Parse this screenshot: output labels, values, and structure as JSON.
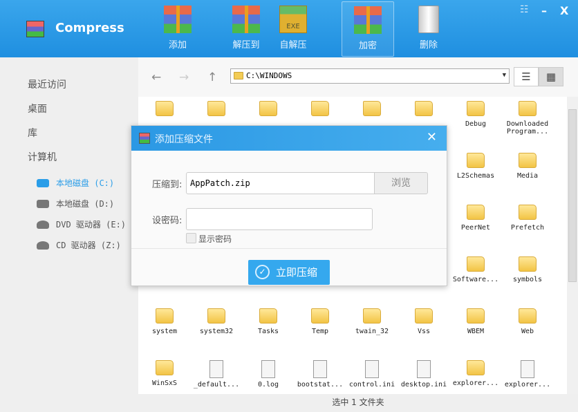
{
  "app": {
    "title": "Compress",
    "brand_color": "#2196e3"
  },
  "toolbar": [
    {
      "label": "添加",
      "icon": "add-archive-icon"
    },
    {
      "label": "解压到",
      "icon": "extract-icon"
    },
    {
      "label": "自解压",
      "icon": "exe-sfx-icon",
      "badge": "EXE"
    },
    {
      "label": "加密",
      "icon": "lock-archive-icon",
      "active": true
    },
    {
      "label": "删除",
      "icon": "trash-icon"
    }
  ],
  "window": {
    "menu": "menu-icon",
    "minimize": "–",
    "close": "X"
  },
  "sidebar": {
    "items": [
      {
        "label": "最近访问"
      },
      {
        "label": "桌面"
      },
      {
        "label": "库"
      },
      {
        "label": "计算机"
      }
    ],
    "drives": [
      {
        "label": "本地磁盘 (C:)",
        "selected": true
      },
      {
        "label": "本地磁盘 (D:)"
      },
      {
        "label": "DVD 驱动器 (E:)"
      },
      {
        "label": "CD 驱动器 (Z:)"
      }
    ]
  },
  "nav": {
    "back": "←",
    "forward": "→",
    "up": "↑",
    "path": "C:\\WINDOWS",
    "list_view": "☰",
    "grid_view": "▦"
  },
  "files": [
    {
      "name": "",
      "type": "folder",
      "row": 0,
      "col": 0
    },
    {
      "name": "",
      "type": "folder",
      "row": 0,
      "col": 1
    },
    {
      "name": "",
      "type": "folder",
      "row": 0,
      "col": 2
    },
    {
      "name": "",
      "type": "folder",
      "row": 0,
      "col": 3
    },
    {
      "name": "",
      "type": "folder",
      "row": 0,
      "col": 4
    },
    {
      "name": "",
      "type": "folder",
      "row": 0,
      "col": 5
    },
    {
      "name": "Debug",
      "type": "folder",
      "row": 0,
      "col": 6
    },
    {
      "name": "Downloaded Program...",
      "type": "folder",
      "row": 0,
      "col": 7
    },
    {
      "name": "L2Schemas",
      "type": "folder",
      "row": 1,
      "col": 6
    },
    {
      "name": "Media",
      "type": "folder",
      "row": 1,
      "col": 7
    },
    {
      "name": "PeerNet",
      "type": "folder",
      "row": 2,
      "col": 6
    },
    {
      "name": "Prefetch",
      "type": "folder",
      "row": 2,
      "col": 7
    },
    {
      "name": "Software...",
      "type": "folder",
      "row": 3,
      "col": 6
    },
    {
      "name": "symbols",
      "type": "folder",
      "row": 3,
      "col": 7
    },
    {
      "name": "system",
      "type": "folder",
      "row": 4,
      "col": 0
    },
    {
      "name": "system32",
      "type": "folder",
      "row": 4,
      "col": 1
    },
    {
      "name": "Tasks",
      "type": "folder",
      "row": 4,
      "col": 2
    },
    {
      "name": "Temp",
      "type": "folder",
      "row": 4,
      "col": 3
    },
    {
      "name": "twain_32",
      "type": "folder",
      "row": 4,
      "col": 4
    },
    {
      "name": "Vss",
      "type": "folder",
      "row": 4,
      "col": 5
    },
    {
      "name": "WBEM",
      "type": "folder",
      "row": 4,
      "col": 6
    },
    {
      "name": "Web",
      "type": "folder",
      "row": 4,
      "col": 7
    },
    {
      "name": "WinSxS",
      "type": "folder",
      "row": 5,
      "col": 0
    },
    {
      "name": "_default...",
      "type": "file",
      "row": 5,
      "col": 1
    },
    {
      "name": "0.log",
      "type": "file",
      "row": 5,
      "col": 2
    },
    {
      "name": "bootstat...",
      "type": "file",
      "row": 5,
      "col": 3
    },
    {
      "name": "control.ini",
      "type": "file",
      "row": 5,
      "col": 4
    },
    {
      "name": "desktop.ini",
      "type": "file",
      "row": 5,
      "col": 5
    },
    {
      "name": "explorer...",
      "type": "folder",
      "row": 5,
      "col": 6
    },
    {
      "name": "explorer...",
      "type": "file",
      "row": 5,
      "col": 7
    }
  ],
  "status": "选中 1 文件夹",
  "dialog": {
    "title": "添加压缩文件",
    "close": "✕",
    "dest_label": "压缩到:",
    "dest_value": "AppPatch.zip",
    "browse": "浏览",
    "pwd_label": "设密码:",
    "pwd_value": "",
    "show_pwd": "显示密码",
    "show_pwd_checked": false,
    "submit": "立即压缩"
  }
}
